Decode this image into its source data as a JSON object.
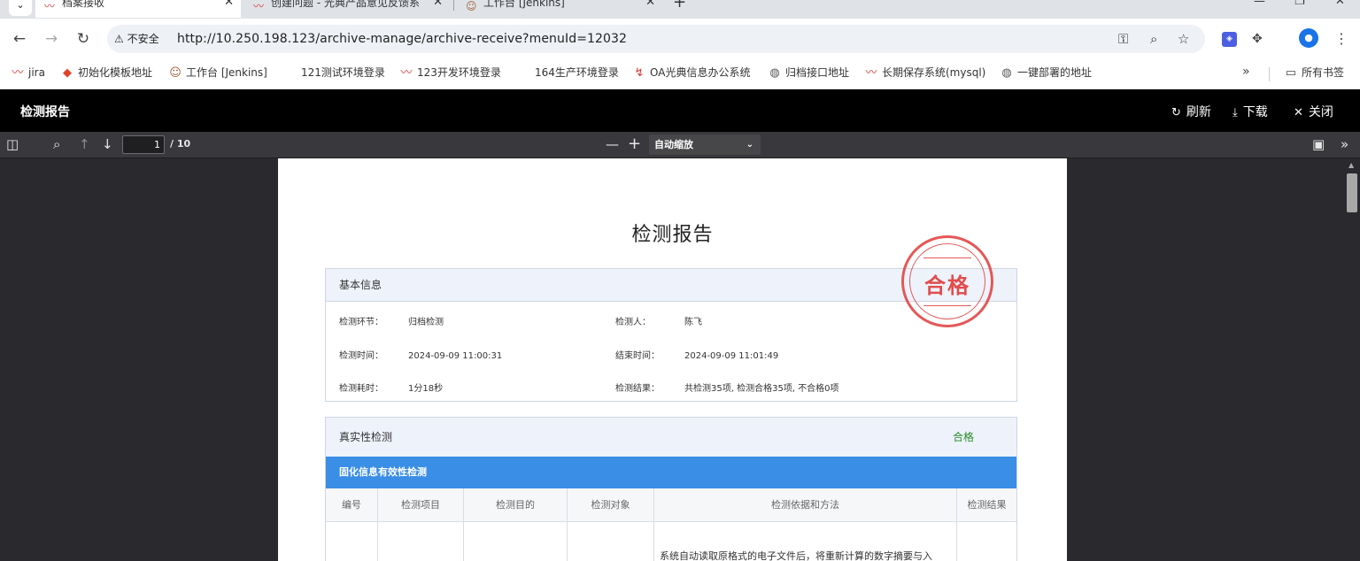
{
  "browser": {
    "tabs": [
      {
        "title": "档案接收",
        "active": true
      },
      {
        "title": "创建问题 - 光典产品意见反馈系",
        "active": false
      },
      {
        "title": "工作台 [Jenkins]",
        "active": false
      }
    ],
    "security_label": "不安全",
    "url": "http://10.250.198.123/archive-manage/archive-receive?menuId=12032"
  },
  "bookmarks": {
    "items": [
      {
        "icon": "wave-logo-icon",
        "label": "jira"
      },
      {
        "icon": "gitlab-icon",
        "label": "初始化模板地址"
      },
      {
        "icon": "jenkins-icon",
        "label": "工作台 [Jenkins]"
      },
      {
        "icon": "",
        "label": "121测试环境登录"
      },
      {
        "icon": "wave-logo-icon",
        "label": "123开发环境登录"
      },
      {
        "icon": "",
        "label": "164生产环境登录"
      },
      {
        "icon": "oa-logo-icon",
        "label": "OA光典信息办公系统"
      },
      {
        "icon": "globe-icon",
        "label": "归档接口地址"
      },
      {
        "icon": "wave-logo-icon",
        "label": "长期保存系统(mysql)"
      },
      {
        "icon": "globe-icon",
        "label": "一键部署的地址"
      }
    ],
    "all_bookmarks_label": "所有书签"
  },
  "app_header": {
    "title": "检测报告",
    "refresh_label": "刷新",
    "download_label": "下载",
    "close_label": "关闭"
  },
  "pdf_toolbar": {
    "page_current": "1",
    "page_total": "/ 10",
    "zoom_label": "自动缩放"
  },
  "report": {
    "title": "检测报告",
    "stamp_text": "合格",
    "basic_section_title": "基本信息",
    "fields": {
      "stage_label": "检测环节：",
      "stage_value": "归档检测",
      "inspector_label": "检测人：",
      "inspector_value": "陈飞",
      "start_label": "检测时间：",
      "start_value": "2024-09-09 11:00:31",
      "end_label": "结束时间：",
      "end_value": "2024-09-09 11:01:49",
      "duration_label": "检测耗时：",
      "duration_value": "1分18秒",
      "result_label": "检测结果：",
      "result_value": "共检测35项, 检测合格35项, 不合格0项"
    },
    "authenticity": {
      "title": "真实性检测",
      "status": "合格",
      "subsection": "固化信息有效性检测",
      "columns": [
        "编号",
        "检测项目",
        "检测目的",
        "检测对象",
        "检测依据和方法",
        "检测结果"
      ],
      "row_text": "系统自动读取原格式的电子文件后，将重新计算的数字摘要与入"
    }
  },
  "colors": {
    "accent_blue": "#3a8ee6",
    "stamp_red": "#e34a4a",
    "pass_green": "#2a8a2a"
  }
}
